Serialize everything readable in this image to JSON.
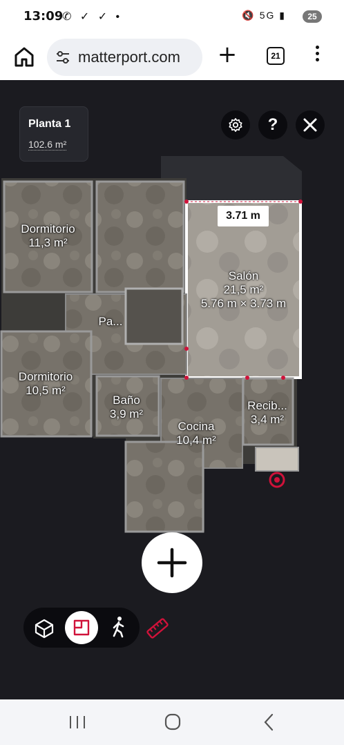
{
  "status_bar": {
    "time": "13:09",
    "left_icons": "✆ ✓ ✓ •",
    "right_icons": "🔇 5G ▮",
    "battery": "25"
  },
  "browser": {
    "url": "matterport.com",
    "tab_count": "21"
  },
  "viewer": {
    "floor_name": "Planta 1",
    "floor_area": "102.6 m²",
    "measure_tag": "3.71 m",
    "rooms": [
      {
        "name": "Dormitorio",
        "area": "11,3 m²"
      },
      {
        "name": "Salón",
        "area": "21,5 m²",
        "dims": "5.76 m × 3.73 m"
      },
      {
        "name": "Pa..."
      },
      {
        "name": "Dormitorio",
        "area": "10,5 m²"
      },
      {
        "name": "Baño",
        "area": "3,9 m²"
      },
      {
        "name": "Recib...",
        "area": "3,4 m²"
      },
      {
        "name": "Cocina",
        "area": "10,4 m²"
      }
    ]
  },
  "colors": {
    "accent": "#d0123a",
    "viewer_bg": "#1b1b20",
    "button_dark": "#0b0b0f"
  },
  "icons": {
    "settings": "gear-icon",
    "help": "question-icon",
    "close": "close-icon",
    "dollhouse": "cube-icon",
    "floorplan": "floorplan-icon",
    "walk": "walking-person-icon",
    "measure": "ruler-icon",
    "add": "plus-icon"
  }
}
